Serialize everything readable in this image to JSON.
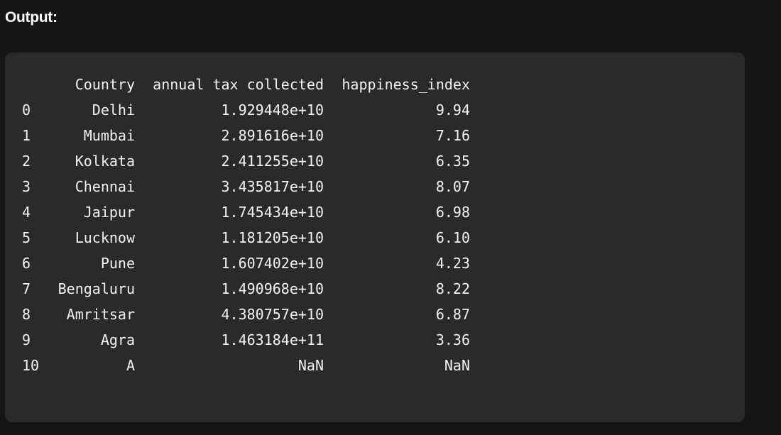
{
  "heading": "Output:",
  "dataframe": {
    "columns": [
      "Country",
      "annual tax collected",
      "happiness_index"
    ],
    "rows": [
      {
        "index": "0",
        "Country": "Delhi",
        "annual_tax_collected": "1.929448e+10",
        "happiness_index": "9.94"
      },
      {
        "index": "1",
        "Country": "Mumbai",
        "annual_tax_collected": "2.891616e+10",
        "happiness_index": "7.16"
      },
      {
        "index": "2",
        "Country": "Kolkata",
        "annual_tax_collected": "2.411255e+10",
        "happiness_index": "6.35"
      },
      {
        "index": "3",
        "Country": "Chennai",
        "annual_tax_collected": "3.435817e+10",
        "happiness_index": "8.07"
      },
      {
        "index": "4",
        "Country": "Jaipur",
        "annual_tax_collected": "1.745434e+10",
        "happiness_index": "6.98"
      },
      {
        "index": "5",
        "Country": "Lucknow",
        "annual_tax_collected": "1.181205e+10",
        "happiness_index": "6.10"
      },
      {
        "index": "6",
        "Country": "Pune",
        "annual_tax_collected": "1.607402e+10",
        "happiness_index": "4.23"
      },
      {
        "index": "7",
        "Country": "Bengaluru",
        "annual_tax_collected": "1.490968e+10",
        "happiness_index": "8.22"
      },
      {
        "index": "8",
        "Country": "Amritsar",
        "annual_tax_collected": "4.380757e+10",
        "happiness_index": "6.87"
      },
      {
        "index": "9",
        "Country": "Agra",
        "annual_tax_collected": "1.463184e+11",
        "happiness_index": "3.36"
      },
      {
        "index": "10",
        "Country": "A",
        "annual_tax_collected": "NaN",
        "happiness_index": "NaN"
      }
    ]
  }
}
